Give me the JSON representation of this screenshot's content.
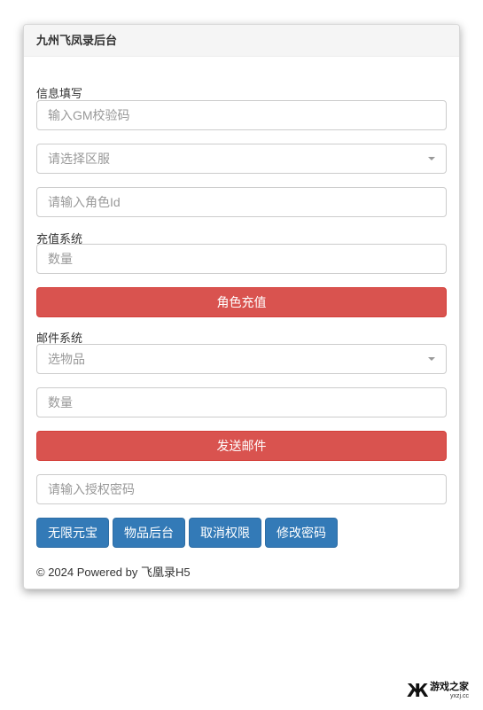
{
  "panel": {
    "title": "九州飞凤录后台"
  },
  "info_section": {
    "label": "信息填写",
    "gm_code_placeholder": "输入GM校验码",
    "server_select_placeholder": "请选择区服",
    "role_id_placeholder": "请输入角色Id"
  },
  "recharge_section": {
    "label": "充值系统",
    "quantity_placeholder": "数量",
    "submit_label": "角色充值"
  },
  "mail_section": {
    "label": "邮件系统",
    "item_select_placeholder": "选物品",
    "quantity_placeholder": "数量",
    "submit_label": "发送邮件"
  },
  "auth": {
    "password_placeholder": "请输入授权密码"
  },
  "action_buttons": [
    "无限元宝",
    "物品后台",
    "取消权限",
    "修改密码"
  ],
  "footer": {
    "text": "© 2024 Powered by 飞凰录H5"
  },
  "watermark": {
    "title": "游戏之家",
    "subtitle": "yxzj.cc"
  },
  "colors": {
    "danger": "#d9534f",
    "primary": "#337ab7",
    "border": "#cccccc",
    "placeholder": "#999999"
  }
}
